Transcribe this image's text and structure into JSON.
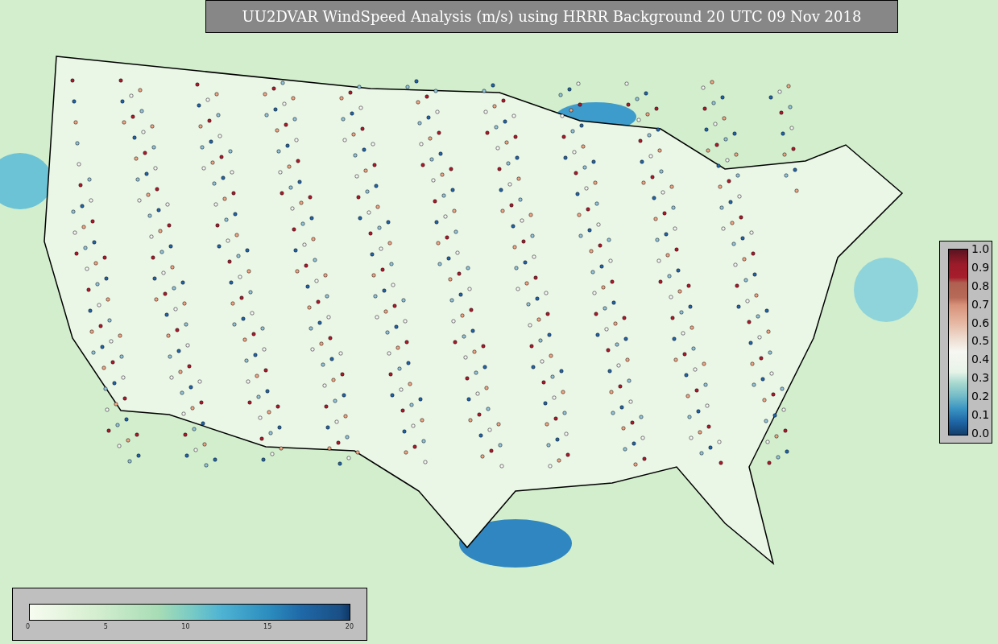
{
  "title": "UU2DVAR WindSpeed Analysis (m/s) using HRRR Background 20 UTC 09 Nov 2018",
  "station_colorbar": {
    "ticks": [
      "1.0",
      "0.9",
      "0.8",
      "0.7",
      "0.6",
      "0.5",
      "0.4",
      "0.3",
      "0.2",
      "0.1",
      "0.0"
    ]
  },
  "wind_colorbar": {
    "ticks": [
      "0",
      "5",
      "10",
      "15",
      "20"
    ]
  }
}
